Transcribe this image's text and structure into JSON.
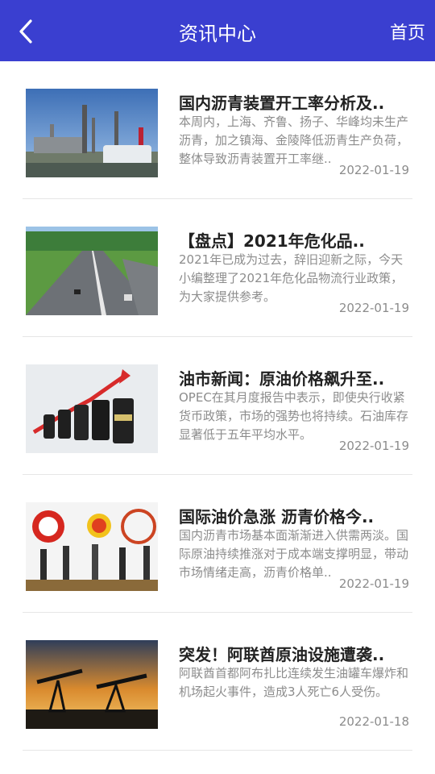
{
  "header": {
    "title": "资讯中心",
    "home_label": "首页",
    "bg_color": "#3a3fd0"
  },
  "articles": [
    {
      "title": "国内沥青装置开工率分析及..",
      "summary": "本周内，上海、齐鲁、扬子、华峰均未生产沥青，加之镇海、金陵降低沥青生产负荷，整体导致沥青装置开工率继..",
      "date": "2022-01-19",
      "image": "refinery-photo"
    },
    {
      "title": "【盘点】2021年危化品..",
      "summary": "2021年已成为过去，辞旧迎新之际，今天小编整理了2021年危化品物流行业政策，为大家提供参考。",
      "date": "2022-01-19",
      "image": "highway-photo"
    },
    {
      "title": "油市新闻：原油价格飙升至..",
      "summary": "OPEC在其月度报告中表示，即使央行收紧货币政策，市场的强势也将持续。石油库存显著低于五年平均水平。",
      "date": "2022-01-19",
      "image": "oil-barrels-chart-photo"
    },
    {
      "title": "国际油价急涨 沥青价格今..",
      "summary": "国内沥青市场基本面渐渐进入供需两淡。国际原油持续推涨对于成本端支撑明显，带动市场情绪走高，沥青价格单..",
      "date": "2022-01-19",
      "image": "oil-company-logos-photo"
    },
    {
      "title": "突发！阿联酋原油设施遭袭..",
      "summary": "阿联酋首都阿布扎比连续发生油罐车爆炸和机场起火事件，造成3人死亡6人受伤。",
      "date": "2022-01-18",
      "image": "oil-pumpjack-sunset-photo"
    }
  ]
}
